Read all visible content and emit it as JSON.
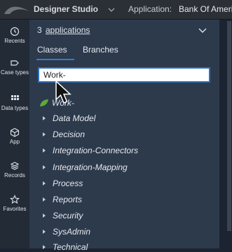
{
  "header": {
    "app_name": "Designer Studio",
    "application_label": "Application:",
    "application_value": "Bank Of Ameri"
  },
  "rail": {
    "items": [
      {
        "label": "Recents",
        "icon": "clock-icon"
      },
      {
        "label": "Case types",
        "icon": "case-icon"
      },
      {
        "label": "Data types",
        "icon": "grid-icon"
      },
      {
        "label": "App",
        "icon": "cube-icon"
      },
      {
        "label": "Records",
        "icon": "stack-icon"
      },
      {
        "label": "Favorites",
        "icon": "star-icon"
      }
    ]
  },
  "panel": {
    "apps_count": "3",
    "apps_link": "applications",
    "tabs": [
      {
        "label": "Classes",
        "active": true
      },
      {
        "label": "Branches",
        "active": false
      }
    ],
    "search": {
      "value": "Work-"
    },
    "tree": {
      "root": "Work-",
      "items": [
        "Data Model",
        "Decision",
        "Integration-Connectors",
        "Integration-Mapping",
        "Process",
        "Reports",
        "Security",
        "SysAdmin",
        "Technical"
      ]
    }
  },
  "colors": {
    "panel_bg": "#2c3a4c",
    "rail_bg": "#232b36",
    "topbar_bg": "#2b2f36",
    "accent": "#2d7fd2",
    "leaf": "#5fa83a"
  }
}
